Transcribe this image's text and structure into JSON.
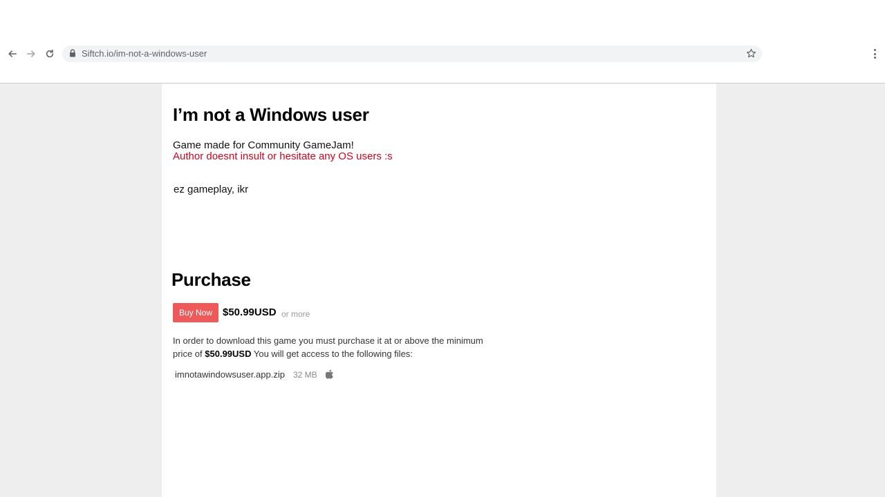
{
  "browser": {
    "url": "Siftch.io/im-not-a-windows-user",
    "icons": {
      "back": "back-arrow-icon",
      "forward": "forward-arrow-icon",
      "reload": "reload-icon",
      "lock": "lock-icon",
      "bookmark": "star-icon",
      "menu": "kebab-menu-icon"
    }
  },
  "game": {
    "title": "I’m not a Windows user",
    "description_line1": "Game made for Community GameJam!",
    "description_line2": "Author doesnt insult or hesitate any OS users :s",
    "description_line3": "ez gameplay, ikr"
  },
  "purchase": {
    "heading": "Purchase",
    "buy_label": "Buy Now",
    "price": "$50.99USD",
    "or_more": "or more",
    "info_line1": "In order to download this game you must purchase it at or above the minimum",
    "info_line2_prefix": "price of",
    "info_line2_price": "$50.99USD",
    "info_line2_suffix": "You will get access to the following files:",
    "file": {
      "name": "imnotawindowsuser.app.zip",
      "size": "32 MB",
      "platform_icon": "apple-icon"
    }
  },
  "colors": {
    "buy_button": "#ee5a5a",
    "notice_red": "#d0021b",
    "page_background": "#eeeeee"
  }
}
